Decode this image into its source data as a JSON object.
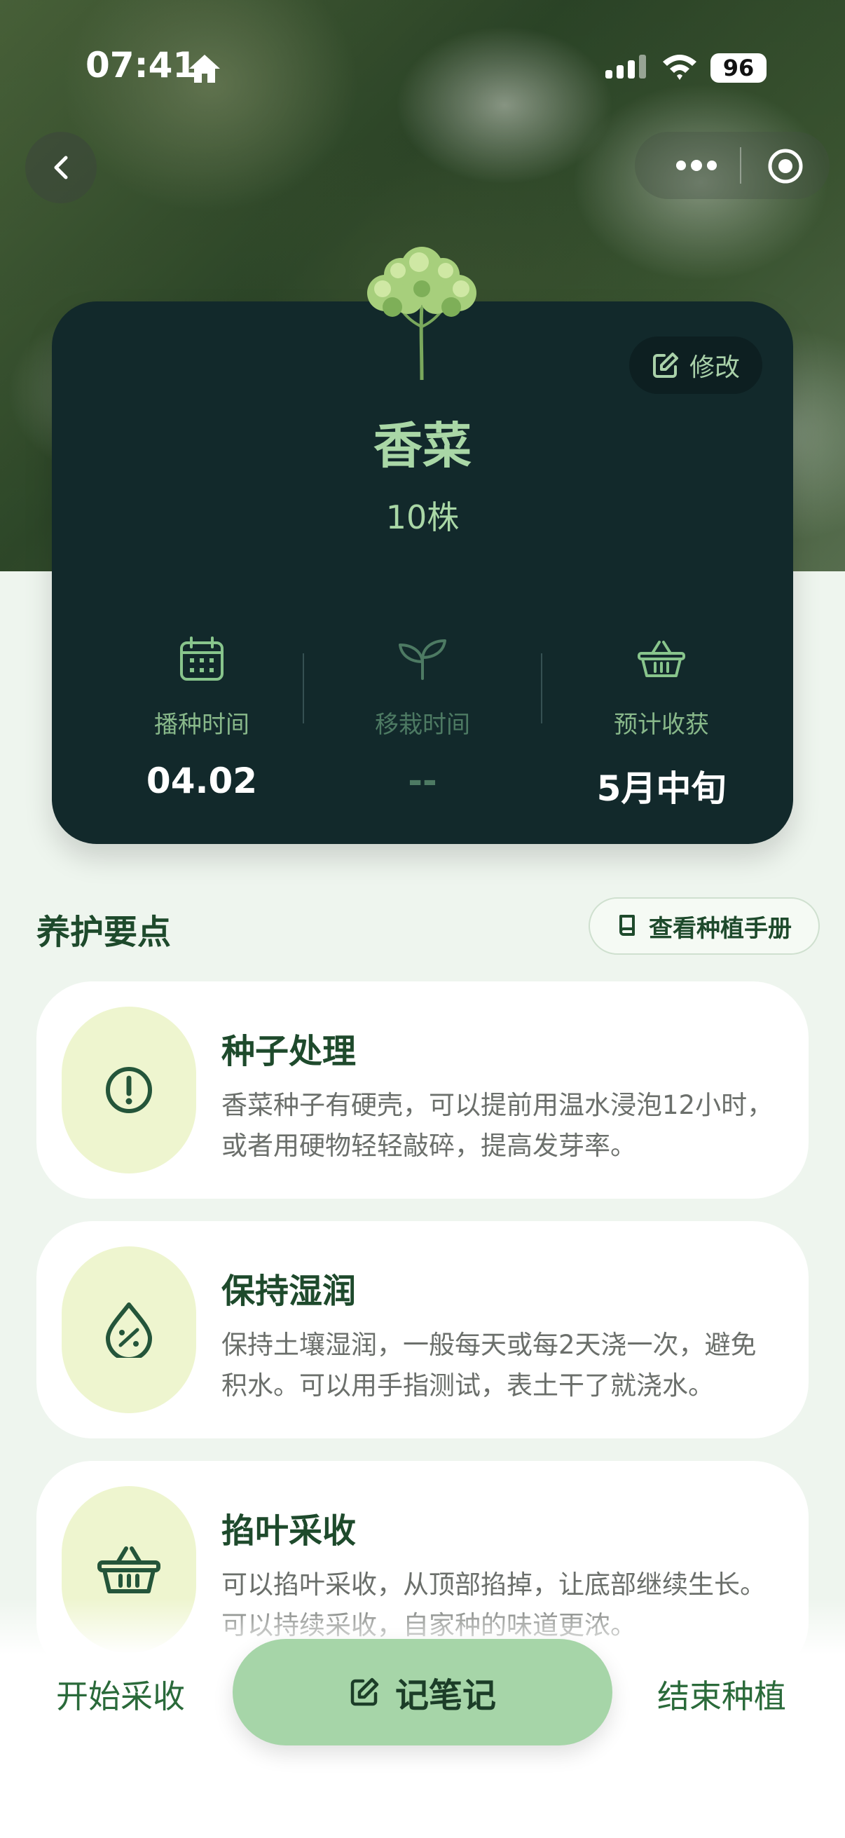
{
  "status_bar": {
    "time": "07:41",
    "battery": "96"
  },
  "card": {
    "edit_label": "修改",
    "plant_name": "香菜",
    "plant_count": "10株",
    "stats": [
      {
        "label": "播种时间",
        "value": "04.02",
        "icon": "calendar-icon"
      },
      {
        "label": "移栽时间",
        "value": "--",
        "icon": "sprout-icon"
      },
      {
        "label": "预计收获",
        "value": "5月中旬",
        "icon": "basket-icon"
      }
    ]
  },
  "care": {
    "title": "养护要点",
    "manual_button": "查看种植手册",
    "tips": [
      {
        "title": "种子处理",
        "desc": "香菜种子有硬壳，可以提前用温水浸泡12小时，或者用硬物轻轻敲碎，提高发芽率。",
        "icon": "alert-circle-icon"
      },
      {
        "title": "保持湿润",
        "desc": "保持土壤湿润，一般每天或每2天浇一次，避免积水。可以用手指测试，表土干了就浇水。",
        "icon": "humidity-drop-icon"
      },
      {
        "title": "掐叶采收",
        "desc": "可以掐叶采收，从顶部掐掉，让底部继续生长。可以持续采收，自家种的味道更浓。",
        "icon": "basket-icon"
      }
    ]
  },
  "bottom_bar": {
    "start_harvest": "开始采收",
    "take_note": "记笔记",
    "end_planting": "结束种植"
  },
  "colors": {
    "card_bg": "#12292b",
    "accent_green": "#a6d5a8",
    "title_green": "#1e4a2c",
    "badge_bg": "#eef5cf"
  }
}
